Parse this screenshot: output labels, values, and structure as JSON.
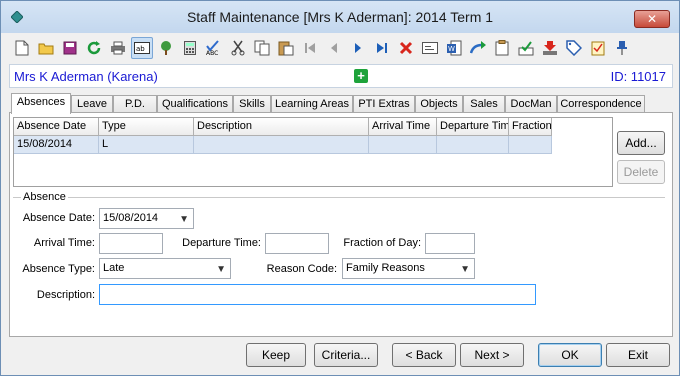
{
  "window": {
    "title": "Staff Maintenance  [Mrs K Aderman]:  2014 Term 1",
    "close_glyph": "✕"
  },
  "toolbar": {
    "icons": [
      "new-icon",
      "open-folder-icon",
      "save-icon",
      "refresh-icon",
      "print-icon",
      "text-field-icon",
      "tree-icon",
      "calculator-icon",
      "spellcheck-icon",
      "cut-icon",
      "copy-icon",
      "paste-icon",
      "first-record-icon",
      "previous-record-icon",
      "next-record-icon",
      "last-record-icon",
      "delete-icon",
      "card-icon",
      "word-icon",
      "forward-arrow-icon",
      "clipboard-icon",
      "stamp-icon",
      "download-icon",
      "tag-icon",
      "checklist-icon",
      "pin-icon"
    ]
  },
  "staff": {
    "name": "Mrs K Aderman (Karena)",
    "plus_glyph": "+",
    "id_label": "ID: 11017"
  },
  "tabs": [
    "Absences",
    "Leave",
    "P.D.",
    "Qualifications",
    "Skills",
    "Learning Areas",
    "PTI Extras",
    "Objects",
    "Sales",
    "DocMan",
    "Correspondence"
  ],
  "grid": {
    "columns": [
      "Absence Date",
      "Type",
      "Description",
      "Arrival Time",
      "Departure Time",
      "Fraction"
    ],
    "rows": [
      [
        "15/08/2014",
        "L",
        "",
        "",
        "",
        ""
      ]
    ]
  },
  "side_buttons": {
    "add": "Add...",
    "delete": "Delete"
  },
  "absence_form": {
    "legend": "Absence",
    "absence_date_label": "Absence Date:",
    "absence_date_value": "15/08/2014",
    "arrival_time_label": "Arrival Time:",
    "arrival_time_value": "",
    "departure_time_label": "Departure Time:",
    "departure_time_value": "",
    "fraction_label": "Fraction of Day:",
    "fraction_value": "",
    "absence_type_label": "Absence Type:",
    "absence_type_value": "Late",
    "reason_code_label": "Reason Code:",
    "reason_code_value": "Family Reasons",
    "description_label": "Description:",
    "description_value": ""
  },
  "footer": {
    "keep": "Keep",
    "criteria": "Criteria...",
    "back": "< Back",
    "next": "Next >",
    "ok": "OK",
    "exit": "Exit"
  },
  "colors": {
    "title_bar": "#c3d7ee",
    "link_text": "#1a1ad4",
    "selected_row": "#dbe6f4",
    "plus_badge": "#1ea33b"
  }
}
